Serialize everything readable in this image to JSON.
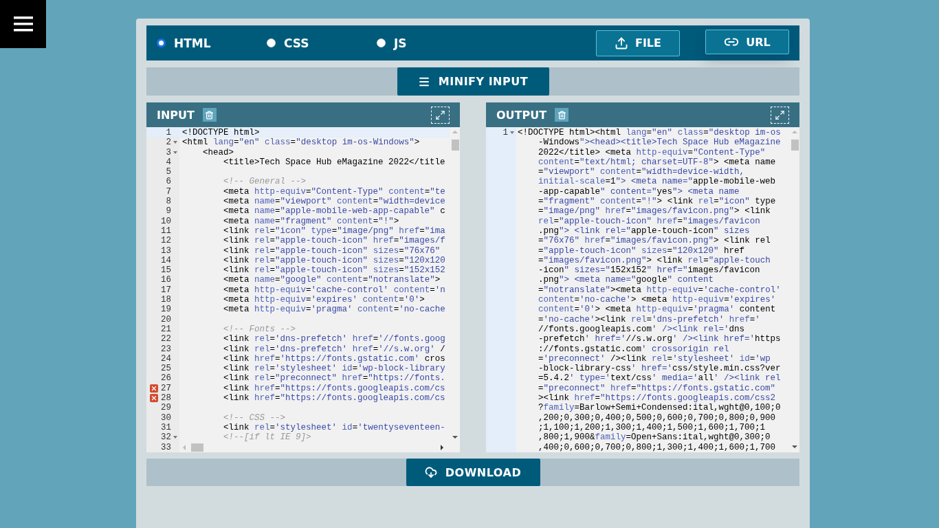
{
  "format_options": [
    {
      "label": "HTML",
      "selected": true
    },
    {
      "label": "CSS",
      "selected": false
    },
    {
      "label": "JS",
      "selected": false
    }
  ],
  "action_buttons": [
    {
      "label": "FILE",
      "kind": "upload"
    },
    {
      "label": "URL",
      "kind": "link"
    }
  ],
  "minify_button": {
    "label": "MINIFY INPUT"
  },
  "panels": [
    {
      "title": "INPUT",
      "lines": [
        {
          "number": "1",
          "text": "<!DOCTYPE html>",
          "fold": false,
          "error": false,
          "current": true
        },
        {
          "number": "2",
          "text": "<html lang=\"en\" class=\"desktop im-os-Windows\">",
          "fold": true,
          "error": false,
          "current": false
        },
        {
          "number": "3",
          "text": "    <head>",
          "fold": true,
          "error": false,
          "current": false
        },
        {
          "number": "4",
          "text": "        <title>Tech Space Hub eMagazine 2022</title",
          "fold": false,
          "error": false,
          "current": false
        },
        {
          "number": "5",
          "fold": false,
          "error": false,
          "current": false
        },
        {
          "number": "6",
          "text": "        <!-- General -->",
          "fold": false,
          "error": false,
          "current": false
        },
        {
          "number": "7",
          "text": "        <meta http-equiv=\"Content-Type\" content=\"te",
          "fold": false,
          "error": false,
          "current": false
        },
        {
          "number": "8",
          "text": "        <meta name=\"viewport\" content=\"width=device",
          "fold": false,
          "error": false,
          "current": false
        },
        {
          "number": "9",
          "text": "        <meta name=\"apple-mobile-web-app-capable\" c",
          "fold": false,
          "error": false,
          "current": false
        },
        {
          "number": "10",
          "text": "        <meta name=\"fragment\" content=\"!\">",
          "fold": false,
          "error": false,
          "current": false
        },
        {
          "number": "11",
          "text": "        <link rel=\"icon\" type=\"image/png\" href=\"ima",
          "fold": false,
          "error": false,
          "current": false
        },
        {
          "number": "12",
          "text": "        <link rel=\"apple-touch-icon\" href=\"images/f",
          "fold": false,
          "error": false,
          "current": false
        },
        {
          "number": "13",
          "text": "        <link rel=\"apple-touch-icon\" sizes=\"76x76\"",
          "fold": false,
          "error": false,
          "current": false
        },
        {
          "number": "14",
          "text": "        <link rel=\"apple-touch-icon\" sizes=\"120x120",
          "fold": false,
          "error": false,
          "current": false
        },
        {
          "number": "15",
          "text": "        <link rel=\"apple-touch-icon\" sizes=\"152x152",
          "fold": false,
          "error": false,
          "current": false
        },
        {
          "number": "16",
          "text": "        <meta name=\"google\" content=\"notranslate\">",
          "fold": false,
          "error": false,
          "current": false
        },
        {
          "number": "17",
          "text": "        <meta http-equiv='cache-control' content='n",
          "fold": false,
          "error": false,
          "current": false
        },
        {
          "number": "18",
          "text": "        <meta http-equiv='expires' content='0'>",
          "fold": false,
          "error": false,
          "current": false
        },
        {
          "number": "19",
          "text": "        <meta http-equiv='pragma' content='no-cache",
          "fold": false,
          "error": false,
          "current": false
        },
        {
          "number": "20",
          "fold": false,
          "error": false,
          "current": false
        },
        {
          "number": "21",
          "text": "        <!-- Fonts -->",
          "fold": false,
          "error": false,
          "current": false
        },
        {
          "number": "22",
          "text": "        <link rel='dns-prefetch' href='//fonts.goog",
          "fold": false,
          "error": false,
          "current": false
        },
        {
          "number": "23",
          "text": "        <link rel='dns-prefetch' href='//s.w.org' /",
          "fold": false,
          "error": false,
          "current": false
        },
        {
          "number": "24",
          "text": "        <link href='https://fonts.gstatic.com' cros",
          "fold": false,
          "error": false,
          "current": false
        },
        {
          "number": "25",
          "text": "        <link rel='stylesheet' id='wp-block-library",
          "fold": false,
          "error": false,
          "current": false
        },
        {
          "number": "26",
          "text": "        <link rel=\"preconnect\" href=\"https://fonts.",
          "fold": false,
          "error": false,
          "current": false
        },
        {
          "number": "27",
          "text": "        <link href=\"https://fonts.googleapis.com/cs",
          "fold": false,
          "error": true,
          "current": false
        },
        {
          "number": "28",
          "text": "        <link href=\"https://fonts.googleapis.com/cs",
          "fold": false,
          "error": true,
          "current": false
        },
        {
          "number": "29",
          "fold": false,
          "error": false,
          "current": false
        },
        {
          "number": "30",
          "text": "        <!-- CSS -->",
          "fold": false,
          "error": false,
          "current": false
        },
        {
          "number": "31",
          "text": "        <link rel='stylesheet' id='twentyseventeen-",
          "fold": false,
          "error": false,
          "current": false
        },
        {
          "number": "32",
          "text": "        <!--[if lt IE 9]>",
          "fold": true,
          "error": false,
          "current": false
        },
        {
          "number": "33",
          "fold": false,
          "error": false,
          "current": false
        }
      ]
    },
    {
      "title": "OUTPUT",
      "lines": [
        {
          "number": "1",
          "fold": true,
          "error": false,
          "current": true,
          "wrapped": [
            "<!DOCTYPE html><html lang=\"en\" class=\"desktop im-os",
            "-Windows\"><head><title>Tech Space Hub eMagazine",
            "2022</title> <meta http-equiv=\"Content-Type\"",
            "content=\"text/html; charset=UTF-8\"> <meta name",
            "=\"viewport\" content=\"width=device-width,",
            "initial-scale=1\"> <meta name=\"apple-mobile-web",
            "-app-capable\" content=\"yes\"> <meta name",
            "=\"fragment\" content=\"!\"> <link rel=\"icon\" type",
            "=\"image/png\" href=\"images/favicon.png\"> <link",
            "rel=\"apple-touch-icon\" href=\"images/favicon",
            ".png\"> <link rel=\"apple-touch-icon\" sizes",
            "=\"76x76\" href=\"images/favicon.png\"> <link rel",
            "=\"apple-touch-icon\" sizes=\"120x120\" href",
            "=\"images/favicon.png\"> <link rel=\"apple-touch",
            "-icon\" sizes=\"152x152\" href=\"images/favicon",
            ".png\"> <meta name=\"google\" content",
            "=\"notranslate\"><meta http-equiv='cache-control'",
            "content='no-cache'> <meta http-equiv='expires'",
            "content='0'> <meta http-equiv='pragma' content",
            "='no-cache'><link rel='dns-prefetch' href='",
            "//fonts.googleapis.com' /><link rel='dns",
            "-prefetch' href='//s.w.org' /><link href='https",
            "://fonts.gstatic.com' crossorigin rel",
            "='preconnect' /><link rel='stylesheet' id='wp",
            "-block-library-css' href='css/style.min.css?ver",
            "=5.4.2' type='text/css' media='all' /><link rel",
            "=\"preconnect\" href=\"https://fonts.gstatic.com\"",
            "><link href=\"https://fonts.googleapis.com/css2",
            "?family=Barlow+Semi+Condensed:ital,wght@0,100;0",
            ",200;0,300;0,400;0,500;0,600;0,700;0,800;0,900",
            ";1,100;1,200;1,300;1,400;1,500;1,600;1,700;1",
            ",800;1,900&family=Open+Sans:ital,wght@0,300;0",
            ",400;0,600;0,700;0,800;1,300;1,400;1,600;1,700"
          ]
        }
      ]
    }
  ],
  "download_button": {
    "label": "DOWNLOAD"
  }
}
